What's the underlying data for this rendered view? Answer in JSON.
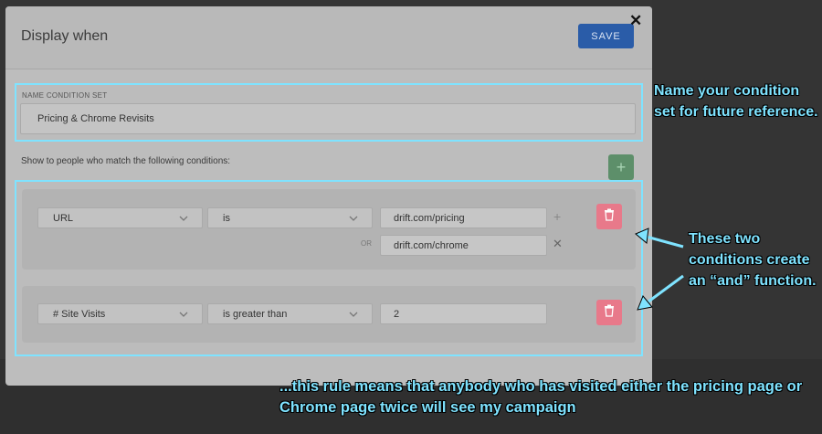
{
  "modal": {
    "title": "Display when",
    "save_label": "SAVE",
    "close_glyph": "✕"
  },
  "name_section": {
    "label": "NAME CONDITION SET",
    "value": "Pricing & Chrome Revisits"
  },
  "conditions_intro": "Show to people who match the following conditions:",
  "add_glyph": "+",
  "conditions": [
    {
      "field": "URL",
      "operator": "is",
      "values": [
        "drift.com/pricing",
        "drift.com/chrome"
      ],
      "or_label": "OR"
    },
    {
      "field": "# Site Visits",
      "operator": "is greater than",
      "values": [
        "2"
      ]
    }
  ],
  "annotations": {
    "name_hint": "Name your condition set for future reference.",
    "and_hint": "These two conditions create an “and” function.",
    "rule_hint": "...this rule means that anybody who has visited either the pricing page or Chrome page twice will see my campaign"
  },
  "colors": {
    "save_button": "#2a5ca8",
    "add_button": "#5d8f6a",
    "delete_button": "#e8798a",
    "highlight": "#7fe3ff"
  },
  "icons": {
    "delete": "trash-icon",
    "chevron": "chevron-down-icon",
    "add": "plus-icon",
    "remove": "close-icon"
  }
}
